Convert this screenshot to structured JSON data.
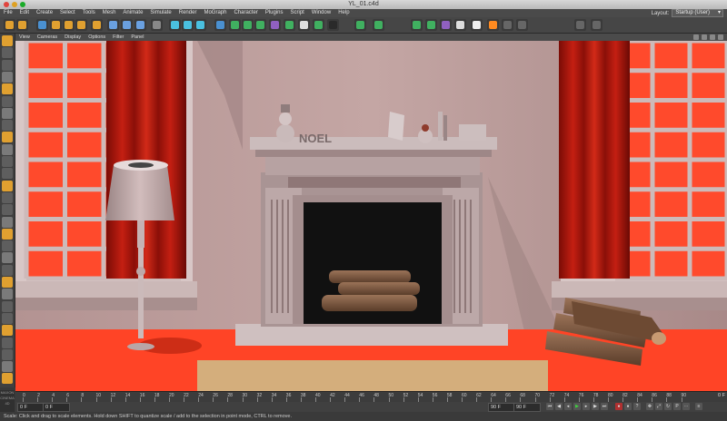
{
  "window": {
    "title": "YL_01.c4d"
  },
  "menu": [
    "File",
    "Edit",
    "Create",
    "Select",
    "Tools",
    "Mesh",
    "Animate",
    "Simulate",
    "Render",
    "MoGraph",
    "Character",
    "Plugins",
    "Script",
    "Window",
    "Help"
  ],
  "layout": {
    "label": "Layout:",
    "value": "Startup (User)"
  },
  "viewport_menu": [
    "View",
    "Cameras",
    "Display",
    "Options",
    "Filter",
    "Panel"
  ],
  "scene": {
    "mantel_text": "NOEL"
  },
  "timeline": {
    "ticks": [
      "0",
      "2",
      "4",
      "6",
      "8",
      "10",
      "12",
      "14",
      "16",
      "18",
      "20",
      "22",
      "24",
      "26",
      "28",
      "30",
      "32",
      "34",
      "36",
      "38",
      "40",
      "42",
      "44",
      "46",
      "48",
      "50",
      "52",
      "54",
      "56",
      "58",
      "60",
      "62",
      "64",
      "66",
      "68",
      "70",
      "72",
      "74",
      "76",
      "78",
      "80",
      "82",
      "84",
      "86",
      "88",
      "90"
    ],
    "current_frame": "0 F"
  },
  "transport": {
    "start": "0 F",
    "min": "0 F",
    "end": "90 F",
    "max": "90 F"
  },
  "status": {
    "text": "Scale: Click and drag to scale elements. Hold down SHIFT to quantize scale / add to the selection in point mode, CTRL to remove."
  },
  "branding": {
    "text": "MAXON CINEMA 4D"
  }
}
